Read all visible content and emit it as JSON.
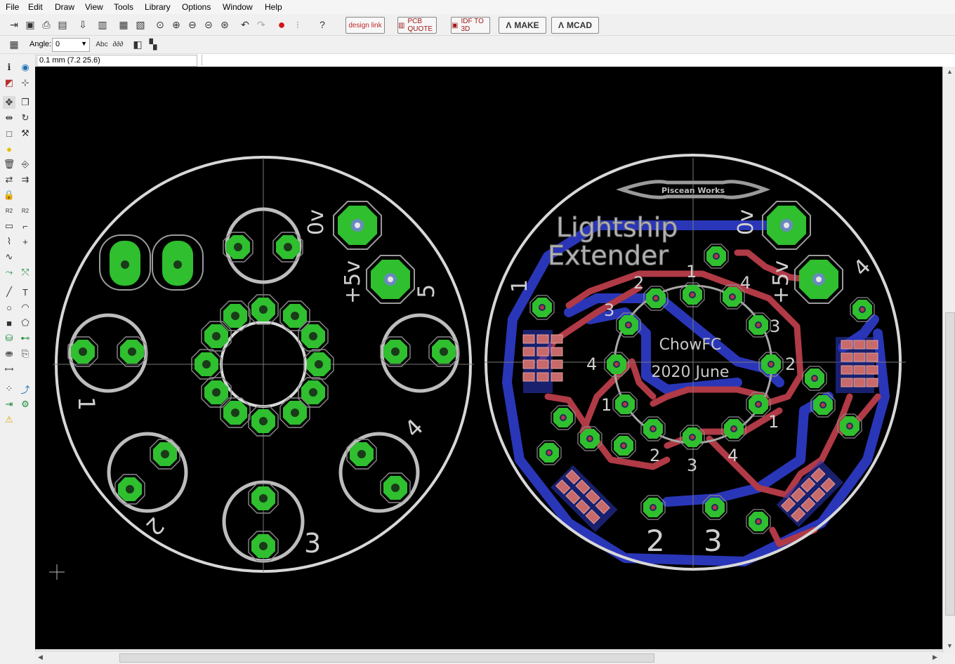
{
  "menus": [
    "File",
    "Edit",
    "Draw",
    "View",
    "Tools",
    "Library",
    "Options",
    "Window",
    "Help"
  ],
  "toolbar": {
    "design_link": "design link",
    "pcb_quote": "PCB QUOTE",
    "idf_to_3d": "IDF TO 3D",
    "make": "MAKE",
    "mcad": "MCAD"
  },
  "param_bar": {
    "angle_label": "Angle:",
    "angle_value": "0"
  },
  "status": {
    "coordinate": "0.1 mm (7.2 25.6)"
  },
  "board_left": {
    "labels": {
      "zero_v": "0v",
      "plus5v": "+5v",
      "n1": "1",
      "n2": "2",
      "n3": "3",
      "n4": "4",
      "n5": "5"
    }
  },
  "board_right": {
    "logo": "Piscean Works",
    "title_line1": "Lightship",
    "title_line2": "Extender",
    "center_name": "ChowFC",
    "center_date": "2020 June",
    "labels": {
      "zero_v": "0v",
      "plus5v": "+5v",
      "n1": "1",
      "n2": "2",
      "n3": "3",
      "n4": "4"
    }
  },
  "colors": {
    "canvas": "#000000",
    "pad_green": "#2fbf2f",
    "top_copper": "#b03a46",
    "bottom_copper": "#2a36b8",
    "silkscreen": "#cfcfcf",
    "smd_pad": "#c86a6a"
  }
}
